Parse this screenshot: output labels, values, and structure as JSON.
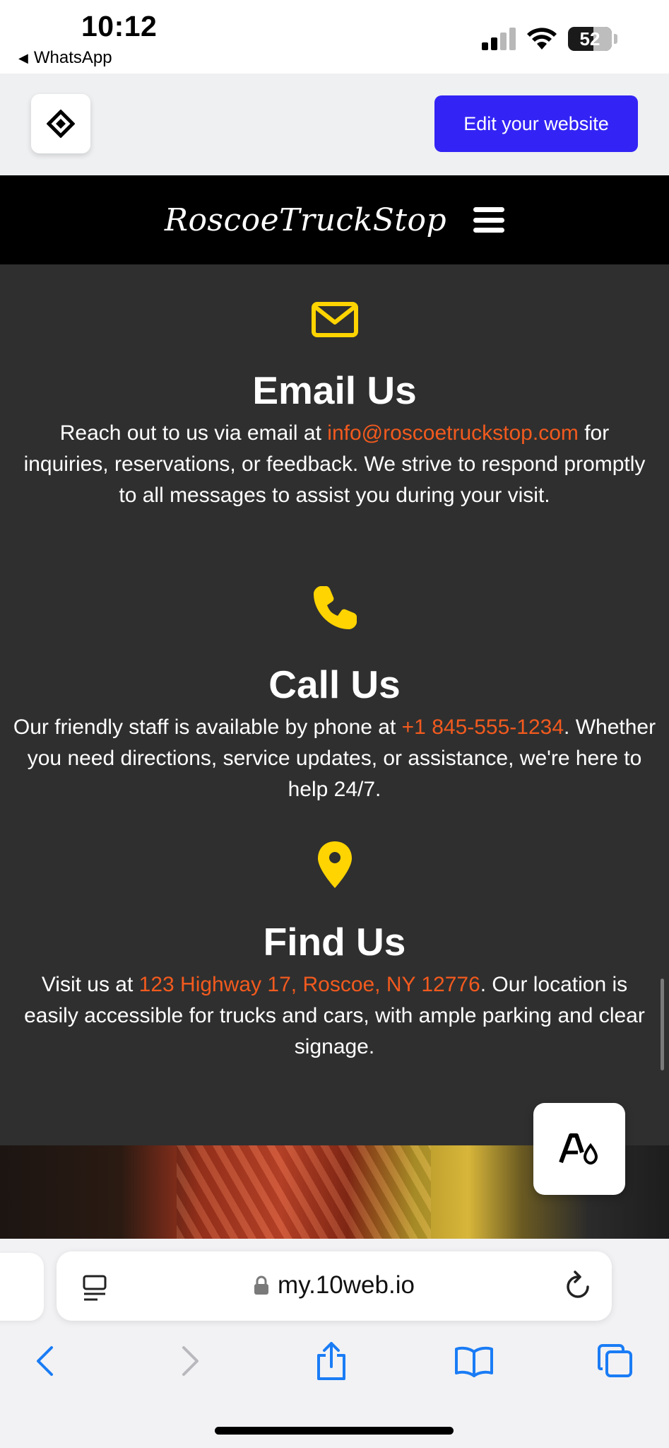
{
  "status_bar": {
    "time": "10:12",
    "back_app": "WhatsApp",
    "battery": "52"
  },
  "editor_bar": {
    "edit_button": "Edit your website"
  },
  "site_header": {
    "brand": "RoscoeTruckStop"
  },
  "sections": {
    "email": {
      "title": "Email Us",
      "text_before": "Reach out to us via email at ",
      "highlight": "info@roscoetruckstop.com",
      "text_after": " for inquiries, reservations, or feedback. We strive to respond promptly to all messages to assist you during your visit."
    },
    "call": {
      "title": "Call Us",
      "text_before": "Our friendly staff is available by phone at ",
      "highlight": "+1 845-555-1234",
      "text_after": ". Whether you need directions, service updates, or assistance, we're here to help 24/7."
    },
    "find": {
      "title": "Find Us",
      "text_before": "Visit us at ",
      "highlight": "123 Highway 17, Roscoe, NY 12776",
      "text_after": ". Our location is easily accessible for trucks and cars, with ample parking and clear signage."
    }
  },
  "browser": {
    "url": "my.10web.io"
  },
  "colors": {
    "accent_yellow": "#ffd400",
    "link_orange": "#f25a1e",
    "edit_button_blue": "#3324f5",
    "ios_blue": "#1a7cf5",
    "content_bg": "#2f2f2f"
  },
  "icons": {
    "email": "envelope-icon",
    "call": "phone-icon",
    "find": "map-pin-icon",
    "fab": "font-style-icon"
  }
}
